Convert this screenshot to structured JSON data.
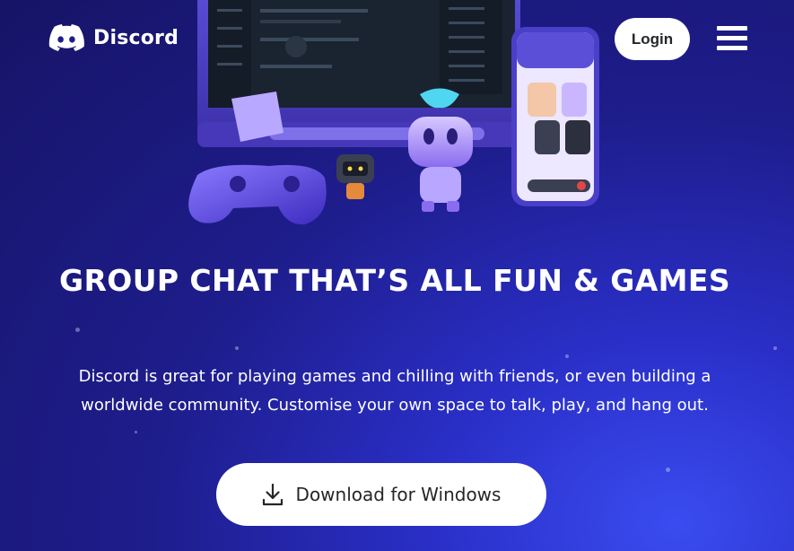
{
  "brand": {
    "name": "Discord",
    "icon": "discord-logo-icon"
  },
  "header": {
    "login_label": "Login",
    "menu_icon": "hamburger-menu-icon"
  },
  "hero": {
    "headline": "GROUP CHAT THAT’S ALL FUN & GAMES",
    "subtitle": "Discord is great for playing games and chilling with friends, or even building a worldwide community. Customise your own space to talk, play, and hang out.",
    "download_label": "Download for Windows",
    "download_icon": "download-icon"
  },
  "colors": {
    "background": "#1e1d8c",
    "accent": "#5865f2",
    "button_bg": "#ffffff",
    "button_text": "#23272a"
  }
}
